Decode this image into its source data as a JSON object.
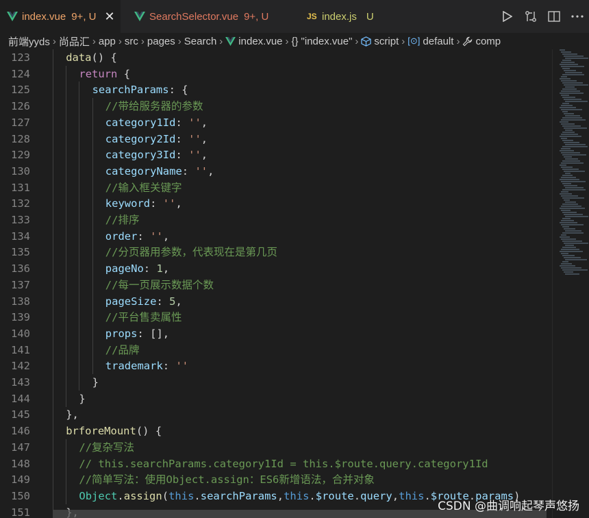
{
  "tabs": [
    {
      "name": "index.vue",
      "status": "9+, U",
      "icon": "vue-icon",
      "active": true,
      "color": "#f0a56a"
    },
    {
      "name": "SearchSelector.vue",
      "status": "9+, U",
      "icon": "vue-icon",
      "active": false,
      "color": "#e07a60"
    },
    {
      "name": "index.js",
      "status": "U",
      "icon": "js-icon",
      "icon_text": "JS",
      "active": false,
      "color": "#cdd070"
    }
  ],
  "editor_actions": [
    "run-icon",
    "compare-changes-icon",
    "split-editor-icon",
    "more-icon"
  ],
  "breadcrumbs": [
    {
      "label": "前端yyds"
    },
    {
      "label": "尚品汇"
    },
    {
      "label": "app"
    },
    {
      "label": "src"
    },
    {
      "label": "pages"
    },
    {
      "label": "Search"
    },
    {
      "label": "index.vue",
      "icon": "vue-icon"
    },
    {
      "label": "\"index.vue\"",
      "icon": "braces-icon",
      "icon_text": "{}"
    },
    {
      "label": "script",
      "icon": "cube-icon"
    },
    {
      "label": "default",
      "icon": "brackets-icon",
      "icon_text": "[⊙]"
    },
    {
      "label": "comp",
      "icon": "wrench-icon"
    }
  ],
  "code_lines": [
    {
      "n": "123",
      "indent": 2,
      "tokens": [
        [
          "f",
          "data"
        ],
        [
          "d",
          "() {"
        ]
      ]
    },
    {
      "n": "124",
      "indent": 3,
      "tokens": [
        [
          "kc",
          "return"
        ],
        [
          "d",
          " {"
        ]
      ]
    },
    {
      "n": "125",
      "indent": 4,
      "tokens": [
        [
          "p",
          "searchParams"
        ],
        [
          "d",
          ": {"
        ]
      ]
    },
    {
      "n": "126",
      "indent": 5,
      "tokens": [
        [
          "c",
          "//带给服务器的参数"
        ]
      ]
    },
    {
      "n": "127",
      "indent": 5,
      "tokens": [
        [
          "p",
          "category1Id"
        ],
        [
          "d",
          ": "
        ],
        [
          "s",
          "''"
        ],
        [
          "d",
          ","
        ]
      ]
    },
    {
      "n": "128",
      "indent": 5,
      "tokens": [
        [
          "p",
          "category2Id"
        ],
        [
          "d",
          ": "
        ],
        [
          "s",
          "''"
        ],
        [
          "d",
          ","
        ]
      ]
    },
    {
      "n": "129",
      "indent": 5,
      "tokens": [
        [
          "p",
          "category3Id"
        ],
        [
          "d",
          ": "
        ],
        [
          "s",
          "''"
        ],
        [
          "d",
          ","
        ]
      ]
    },
    {
      "n": "130",
      "indent": 5,
      "tokens": [
        [
          "p",
          "categoryName"
        ],
        [
          "d",
          ": "
        ],
        [
          "s",
          "''"
        ],
        [
          "d",
          ","
        ]
      ]
    },
    {
      "n": "131",
      "indent": 5,
      "tokens": [
        [
          "c",
          "//输入框关键字"
        ]
      ]
    },
    {
      "n": "132",
      "indent": 5,
      "tokens": [
        [
          "p",
          "keyword"
        ],
        [
          "d",
          ": "
        ],
        [
          "s",
          "''"
        ],
        [
          "d",
          ","
        ]
      ]
    },
    {
      "n": "133",
      "indent": 5,
      "tokens": [
        [
          "c",
          "//排序"
        ]
      ]
    },
    {
      "n": "134",
      "indent": 5,
      "tokens": [
        [
          "p",
          "order"
        ],
        [
          "d",
          ": "
        ],
        [
          "s",
          "''"
        ],
        [
          "d",
          ","
        ]
      ]
    },
    {
      "n": "135",
      "indent": 5,
      "tokens": [
        [
          "c",
          "//分页器用参数，代表现在是第几页"
        ]
      ]
    },
    {
      "n": "136",
      "indent": 5,
      "tokens": [
        [
          "p",
          "pageNo"
        ],
        [
          "d",
          ": "
        ],
        [
          "n",
          "1"
        ],
        [
          "d",
          ","
        ]
      ]
    },
    {
      "n": "137",
      "indent": 5,
      "tokens": [
        [
          "c",
          "//每一页展示数据个数"
        ]
      ]
    },
    {
      "n": "138",
      "indent": 5,
      "tokens": [
        [
          "p",
          "pageSize"
        ],
        [
          "d",
          ": "
        ],
        [
          "n",
          "5"
        ],
        [
          "d",
          ","
        ]
      ]
    },
    {
      "n": "139",
      "indent": 5,
      "tokens": [
        [
          "c",
          "//平台售卖属性"
        ]
      ]
    },
    {
      "n": "140",
      "indent": 5,
      "tokens": [
        [
          "p",
          "props"
        ],
        [
          "d",
          ": [],"
        ]
      ]
    },
    {
      "n": "141",
      "indent": 5,
      "tokens": [
        [
          "c",
          "//品牌"
        ]
      ]
    },
    {
      "n": "142",
      "indent": 5,
      "tokens": [
        [
          "p",
          "trademark"
        ],
        [
          "d",
          ": "
        ],
        [
          "s",
          "''"
        ]
      ]
    },
    {
      "n": "143",
      "indent": 4,
      "tokens": [
        [
          "d",
          "}"
        ]
      ]
    },
    {
      "n": "144",
      "indent": 3,
      "tokens": [
        [
          "d",
          "}"
        ]
      ]
    },
    {
      "n": "145",
      "indent": 2,
      "tokens": [
        [
          "d",
          "},"
        ]
      ]
    },
    {
      "n": "146",
      "indent": 2,
      "tokens": [
        [
          "f",
          "brforeMount"
        ],
        [
          "d",
          "() {"
        ]
      ]
    },
    {
      "n": "147",
      "indent": 3,
      "tokens": [
        [
          "c",
          "//复杂写法"
        ]
      ]
    },
    {
      "n": "148",
      "indent": 3,
      "tokens": [
        [
          "c",
          "// this.searchParams.category1Id = this.$route.query.category1Id"
        ]
      ]
    },
    {
      "n": "149",
      "indent": 3,
      "tokens": [
        [
          "c",
          "//简单写法：使用Object.assign：ES6新增语法，合并对象"
        ]
      ]
    },
    {
      "n": "150",
      "indent": 3,
      "tokens": [
        [
          "t",
          "Object"
        ],
        [
          "d",
          "."
        ],
        [
          "f",
          "assign"
        ],
        [
          "d",
          "("
        ],
        [
          "k",
          "this"
        ],
        [
          "d",
          "."
        ],
        [
          "p",
          "searchParams"
        ],
        [
          "d",
          ","
        ],
        [
          "k",
          "this"
        ],
        [
          "d",
          "."
        ],
        [
          "p",
          "$route"
        ],
        [
          "d",
          "."
        ],
        [
          "p",
          "query"
        ],
        [
          "d",
          ","
        ],
        [
          "k",
          "this"
        ],
        [
          "d",
          "."
        ],
        [
          "p",
          "$route"
        ],
        [
          "d",
          "."
        ],
        [
          "p",
          "params"
        ],
        [
          "d",
          ")"
        ]
      ]
    },
    {
      "n": "151",
      "indent": 2,
      "tokens": [
        [
          "d",
          "},"
        ]
      ]
    }
  ],
  "watermark": "CSDN @曲调响起琴声悠扬"
}
